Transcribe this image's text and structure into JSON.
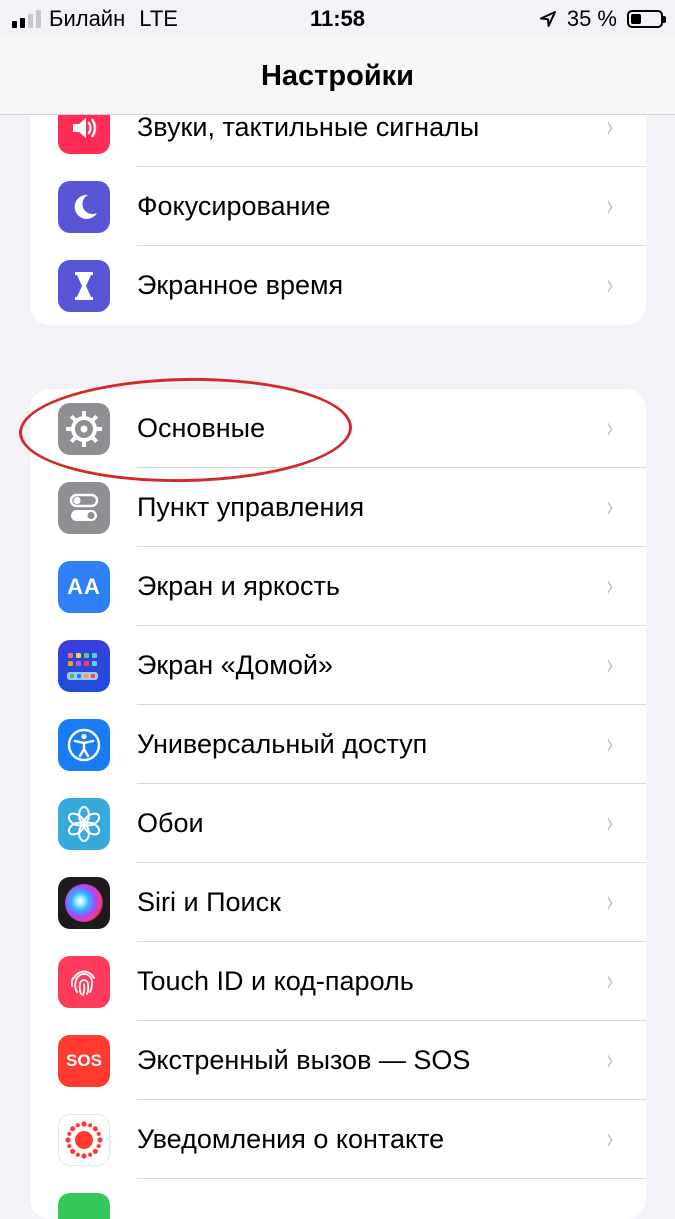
{
  "status_bar": {
    "carrier": "Билайн",
    "network": "LTE",
    "time": "11:58",
    "battery_percent": "35 %",
    "battery_level": 0.35,
    "signal_bars_active": 2,
    "signal_bars_total": 4
  },
  "nav": {
    "title": "Настройки"
  },
  "groups": [
    {
      "items": [
        {
          "label": "Звуки, тактильные сигналы",
          "icon": "speaker-icon",
          "color": "#ff2d55"
        },
        {
          "label": "Фокусирование",
          "icon": "moon-icon",
          "color": "#5856d6"
        },
        {
          "label": "Экранное время",
          "icon": "hourglass-icon",
          "color": "#5856d6"
        }
      ]
    },
    {
      "items": [
        {
          "label": "Основные",
          "icon": "gear-icon",
          "color": "#8e8e93"
        },
        {
          "label": "Пункт управления",
          "icon": "toggles-icon",
          "color": "#8e8e93"
        },
        {
          "label": "Экран и яркость",
          "icon": "text-size-icon",
          "color": "#2f7ff7",
          "glyph": "AA"
        },
        {
          "label": "Экран «Домой»",
          "icon": "home-screen-icon",
          "color": "#1d4fd8"
        },
        {
          "label": "Универсальный доступ",
          "icon": "accessibility-icon",
          "color": "#1a7cf5"
        },
        {
          "label": "Обои",
          "icon": "flower-icon",
          "color": "#36aadc"
        },
        {
          "label": "Siri и Поиск",
          "icon": "siri-icon",
          "color": "#1c1c1e"
        },
        {
          "label": "Touch ID и код-пароль",
          "icon": "fingerprint-icon",
          "color": "#ff3b5c"
        },
        {
          "label": "Экстренный вызов — SOS",
          "icon": "sos-icon",
          "color": "#ff3b30",
          "glyph": "SOS"
        },
        {
          "label": "Уведомления о контакте",
          "icon": "exposure-icon",
          "color": "#ffffff"
        }
      ]
    }
  ],
  "chevron": "›",
  "highlight_color": "#d22a2a"
}
